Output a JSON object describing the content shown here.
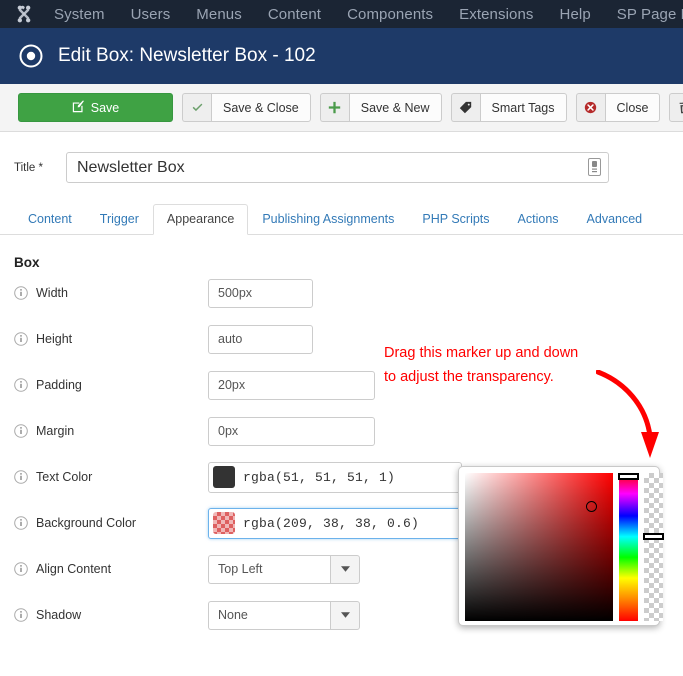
{
  "admin_nav": {
    "logo_icon": "joomla-logo-icon",
    "items": [
      {
        "label": "System"
      },
      {
        "label": "Users"
      },
      {
        "label": "Menus"
      },
      {
        "label": "Content"
      },
      {
        "label": "Components"
      },
      {
        "label": "Extensions"
      },
      {
        "label": "Help"
      },
      {
        "label": "SP Page Builder"
      }
    ]
  },
  "header": {
    "icon": "target-circle-icon",
    "title": "Edit Box: Newsletter Box - 102",
    "bg_color": "#1e3a68"
  },
  "toolbar": {
    "save_label": "Save",
    "save_icon": "edit-square-icon",
    "save_close_label": "Save & Close",
    "save_close_icon": "check-icon",
    "save_new_label": "Save & New",
    "save_new_icon": "plus-icon",
    "smart_tags_label": "Smart Tags",
    "smart_tags_icon": "tag-icon",
    "close_label": "Close",
    "close_icon": "cancel-circle-icon",
    "delete_icon": "trash-icon",
    "save_bg_color": "#3fa244"
  },
  "title_field": {
    "label": "Title *",
    "value": "Newsletter Box",
    "placeholder": "",
    "trailing_icon": "batch-icon"
  },
  "tabs": [
    {
      "label": "Content",
      "active": false
    },
    {
      "label": "Trigger",
      "active": false
    },
    {
      "label": "Appearance",
      "active": true
    },
    {
      "label": "Publishing Assignments",
      "active": false
    },
    {
      "label": "PHP Scripts",
      "active": false
    },
    {
      "label": "Actions",
      "active": false
    },
    {
      "label": "Advanced",
      "active": false
    }
  ],
  "form": {
    "section_heading": "Box",
    "info_icon": "info-circle-icon",
    "rows": [
      {
        "label": "Width",
        "type": "text",
        "value": "500px",
        "width": "short"
      },
      {
        "label": "Height",
        "type": "text",
        "value": "auto",
        "width": "short"
      },
      {
        "label": "Padding",
        "type": "text",
        "value": "20px",
        "width": "mid"
      },
      {
        "label": "Margin",
        "type": "text",
        "value": "0px",
        "width": "mid"
      },
      {
        "label": "Text Color",
        "type": "color",
        "value": "rgba(51, 51, 51, 1)",
        "swatch": "#333333",
        "transparent": false,
        "focused": false
      },
      {
        "label": "Background Color",
        "type": "color",
        "value": "rgba(209, 38, 38, 0.6)",
        "swatch": "#d12626",
        "transparent": true,
        "focused": true
      },
      {
        "label": "Align Content",
        "type": "select",
        "value": "Top Left"
      },
      {
        "label": "Shadow",
        "type": "select",
        "value": "None"
      }
    ]
  },
  "annotation": {
    "line1": "Drag this marker up and down",
    "line2": "to adjust the transparency.",
    "color": "#ff0000",
    "arrow_icon": "curved-down-arrow-icon"
  },
  "color_picker": {
    "saturation_area_name": "saturation-value-area",
    "hue_slider_name": "hue-slider",
    "alpha_slider_name": "alpha-slider",
    "selected_hue_hex": "#ff0000"
  }
}
